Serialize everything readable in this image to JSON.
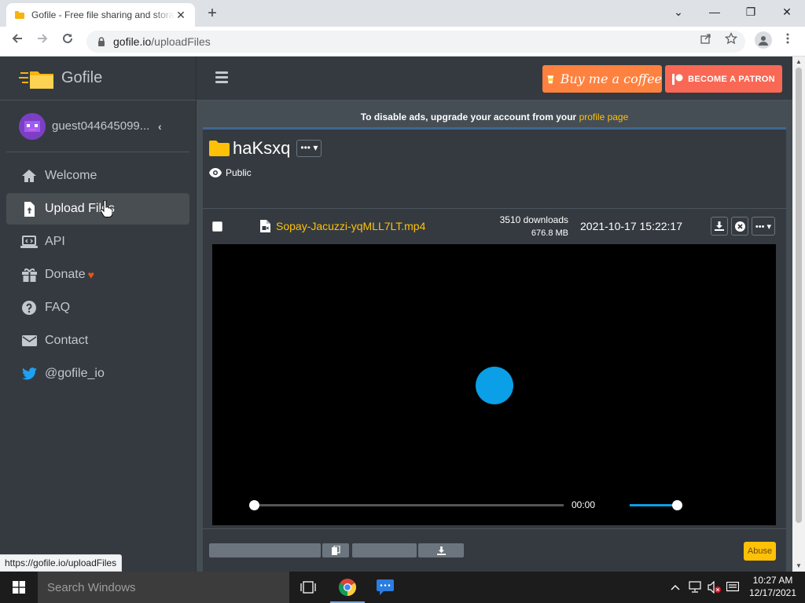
{
  "browser": {
    "tab_title": "Gofile - Free file sharing and storage",
    "tab_close": "✕",
    "new_tab": "+",
    "window_controls": {
      "minimize": "—",
      "restore": "❐",
      "close": "✕",
      "tab_list": "⌄"
    },
    "url_host": "gofile.io",
    "url_path": "/uploadFiles",
    "status_url": "https://gofile.io/uploadFiles"
  },
  "sidebar": {
    "brand": "Gofile",
    "user_name": "guest044645099...",
    "items": [
      {
        "label": "Welcome",
        "icon": "home-icon"
      },
      {
        "label": "Upload Files",
        "icon": "file-upload-icon",
        "active": true
      },
      {
        "label": "API",
        "icon": "laptop-code-icon"
      },
      {
        "label": "Donate",
        "icon": "gift-icon",
        "badge": "♥"
      },
      {
        "label": "FAQ",
        "icon": "question-circle-icon"
      },
      {
        "label": "Contact",
        "icon": "envelope-icon"
      },
      {
        "label": "@gofile_io",
        "icon": "twitter-icon"
      }
    ]
  },
  "header": {
    "buy_coffee": "Buy me a coffee",
    "become_patron": "BECOME A PATRON"
  },
  "content": {
    "ads_note_prefix": "To disable ads, upgrade your account from your",
    "ads_note_link": "profile page",
    "folder_name": "haKsxq",
    "folder_menu": "••• ▾",
    "visibility": "Public",
    "file": {
      "name": "Sopay-Jacuzzi-yqMLL7LT.mp4",
      "downloads": "3510 downloads",
      "size": "676.8 MB",
      "date": "2021-10-17 15:22:17",
      "menu": "••• ▾"
    },
    "player": {
      "time": "00:00",
      "progress": 0,
      "volume": 1.0
    },
    "abuse_label": "Abuse"
  },
  "taskbar": {
    "search_placeholder": "Search Windows",
    "clock_time": "10:27 AM",
    "clock_date": "12/17/2021"
  },
  "colors": {
    "accent_yellow": "#ffc107",
    "sidebar_bg": "#343a40",
    "content_bg": "#454d55",
    "coffee_orange": "#ff813f",
    "patreon_red": "#f96854",
    "spinner_blue": "#0a9fe6"
  }
}
